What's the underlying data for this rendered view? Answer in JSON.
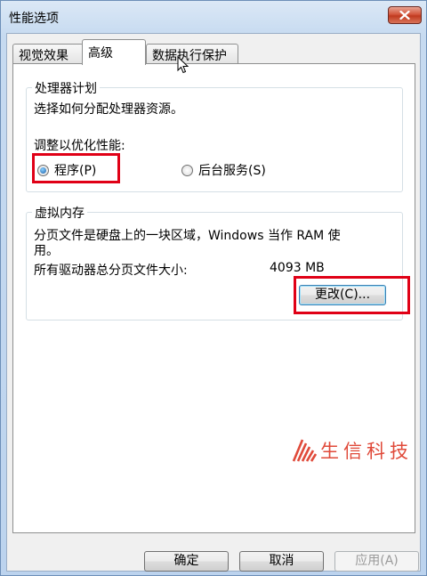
{
  "window": {
    "title": "性能选项"
  },
  "tabs": [
    {
      "label": "视觉效果"
    },
    {
      "label": "高级"
    },
    {
      "label": "数据执行保护"
    }
  ],
  "processor_group": {
    "title": "处理器计划",
    "description": "选择如何分配处理器资源。",
    "adjust_label": "调整以优化性能:",
    "option_programs": "程序(P)",
    "option_services": "后台服务(S)"
  },
  "virtual_memory": {
    "title": "虚拟内存",
    "description_line1": "分页文件是硬盘上的一块区域，Windows 当作 RAM 使",
    "description_line2": "用。",
    "total_label": "所有驱动器总分页文件大小:",
    "total_value": "4093 MB",
    "change_button": "更改(C)..."
  },
  "buttons": {
    "ok": "确定",
    "cancel": "取消",
    "apply": "应用(A)"
  },
  "watermark": {
    "text": "生信科技"
  },
  "colors": {
    "highlight": "#e00016",
    "close_button": "#c9482c",
    "watermark": "#e04a3a"
  }
}
